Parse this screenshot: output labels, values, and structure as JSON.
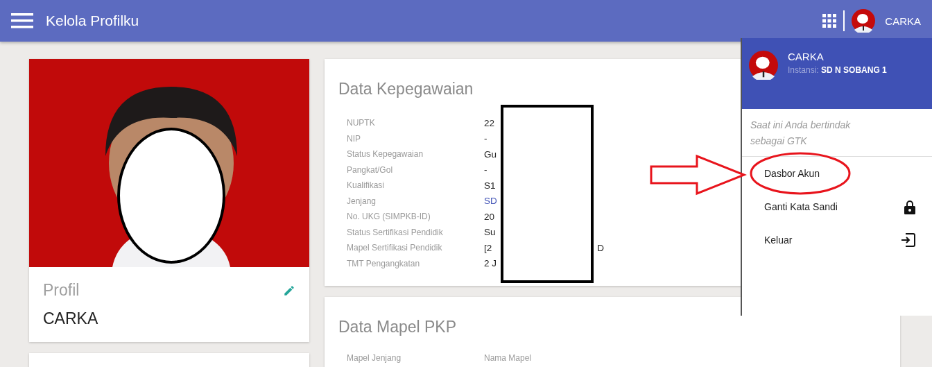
{
  "app_bar": {
    "title": "Kelola Profilku",
    "user_name": "CARKA"
  },
  "profile_card": {
    "heading": "Profil",
    "name": "CARKA"
  },
  "employment_card": {
    "title": "Data Kepegawaian",
    "rows": [
      {
        "label": "NUPTK",
        "value": "22"
      },
      {
        "label": "NIP",
        "value": "-"
      },
      {
        "label": "Status Kepegawaian",
        "value": "Gu"
      },
      {
        "label": "Pangkat/Gol",
        "value": "-"
      },
      {
        "label": "Kualifikasi",
        "value": "S1"
      },
      {
        "label": "Jenjang",
        "value": "SD",
        "link": true
      },
      {
        "label": "No. UKG (SIMPKB-ID)",
        "value": "20"
      },
      {
        "label": "Status Sertifikasi Pendidik",
        "value": "Su"
      },
      {
        "label": "Mapel Sertifikasi Pendidik",
        "value": "[2",
        "value_end": "D"
      },
      {
        "label": "TMT Pengangkatan",
        "value": "2 J"
      }
    ]
  },
  "subject_card": {
    "title": "Data Mapel PKP",
    "columns": [
      "Mapel Jenjang",
      "Nama Mapel"
    ]
  },
  "account_menu": {
    "name": "CARKA",
    "institution_label": "Instansi:",
    "institution": "SD N SOBANG 1",
    "role_note": "Saat ini Anda bertindak sebagai GTK",
    "items": [
      {
        "label": "Dasbor Akun",
        "kind": "plain",
        "highlighted": true
      },
      {
        "label": "Ganti Kata Sandi",
        "kind": "lock",
        "highlighted": false
      },
      {
        "label": "Keluar",
        "kind": "exit",
        "highlighted": false
      }
    ]
  }
}
